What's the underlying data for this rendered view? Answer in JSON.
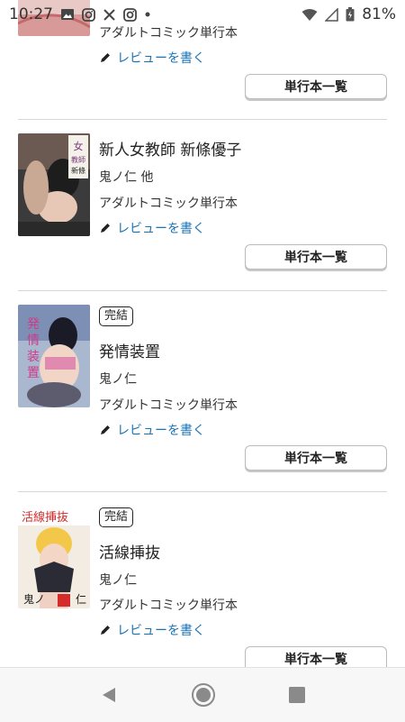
{
  "status_bar": {
    "time": "10:27",
    "battery_percent": "81%",
    "left_icons": [
      "image-icon",
      "instagram-icon",
      "x-icon",
      "instagram-icon",
      "dot-icon"
    ],
    "right_icons": [
      "wifi-icon",
      "signal-icon",
      "battery-icon"
    ]
  },
  "top_partial_item": {
    "category": "アダルトコミック単行本",
    "review_label": "レビューを書く",
    "list_button": "単行本一覧"
  },
  "items": [
    {
      "badge": "",
      "title": "新人女教師 新條優子",
      "author": "鬼ノ仁 他",
      "category": "アダルトコミック単行本",
      "review_label": "レビューを書く",
      "list_button": "単行本一覧",
      "cover_text": "女教師 新條優子"
    },
    {
      "badge": "完結",
      "title": "発情装置",
      "author": "鬼ノ仁",
      "category": "アダルトコミック単行本",
      "review_label": "レビューを書く",
      "list_button": "単行本一覧",
      "cover_text": "発情装置"
    },
    {
      "badge": "完結",
      "title": "活線挿抜",
      "author": "鬼ノ仁",
      "category": "アダルトコミック単行本",
      "review_label": "レビューを書く",
      "list_button": "単行本一覧",
      "cover_text": "活線挿抜"
    }
  ],
  "nav_bar": {
    "buttons": [
      "back-icon",
      "home-icon",
      "recents-icon"
    ]
  },
  "colors": {
    "link": "#1a73b5",
    "divider": "#d6d6d6",
    "nav_bg": "#f7f7f7"
  }
}
